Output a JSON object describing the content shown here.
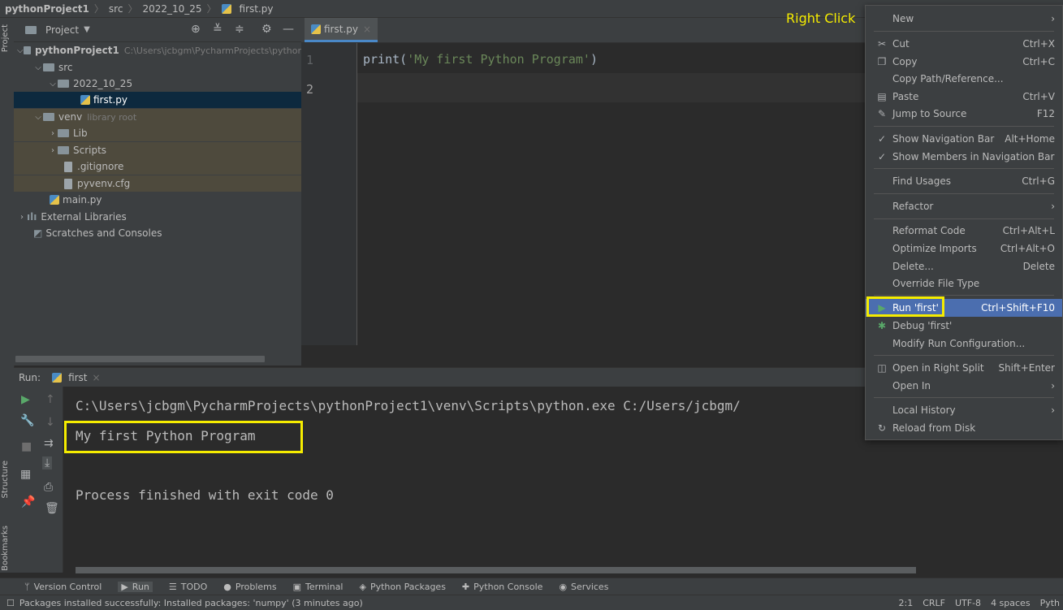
{
  "breadcrumb": {
    "project": "pythonProject1",
    "items": [
      "src",
      "2022_10_25",
      "first.py"
    ]
  },
  "side_tabs": {
    "project": "Project",
    "structure": "Structure",
    "bookmarks": "Bookmarks"
  },
  "project_panel": {
    "title": "Project",
    "tree": [
      {
        "label": "pythonProject1",
        "extra": "C:\\Users\\jcbgm\\PycharmProjects\\pythor",
        "kind": "folder",
        "expanded": true
      },
      {
        "label": "src",
        "kind": "folder",
        "expanded": true
      },
      {
        "label": "2022_10_25",
        "kind": "folder",
        "expanded": true
      },
      {
        "label": "first.py",
        "kind": "python",
        "selected": true
      },
      {
        "label": "venv",
        "extra": "library root",
        "kind": "folder",
        "expanded": true
      },
      {
        "label": "Lib",
        "kind": "folder",
        "expanded": false
      },
      {
        "label": "Scripts",
        "kind": "folder",
        "expanded": false
      },
      {
        "label": ".gitignore",
        "kind": "file"
      },
      {
        "label": "pyvenv.cfg",
        "kind": "file"
      },
      {
        "label": "main.py",
        "kind": "python"
      },
      {
        "label": "External Libraries",
        "kind": "library",
        "expanded": false
      },
      {
        "label": "Scratches and Consoles",
        "kind": "scratch"
      }
    ]
  },
  "editor": {
    "tab_label": "first.py",
    "line_numbers": [
      "1",
      "2"
    ],
    "code_prefix": "print(",
    "code_string": "'My first Python Program'",
    "code_suffix": ")"
  },
  "annotation": {
    "right_click": "Right Click"
  },
  "run_panel": {
    "label": "Run:",
    "config": "first",
    "lines": [
      "C:\\Users\\jcbgm\\PycharmProjects\\pythonProject1\\venv\\Scripts\\python.exe C:/Users/jcbgm/",
      "My first Python Program",
      "Process finished with exit code 0"
    ]
  },
  "context_menu": {
    "items": [
      {
        "label": "New",
        "shortcut": "",
        "submenu": true,
        "icon": ""
      },
      {
        "label": "Cut",
        "shortcut": "Ctrl+X",
        "icon": "scissors-icon"
      },
      {
        "label": "Copy",
        "shortcut": "Ctrl+C",
        "icon": "copy-icon"
      },
      {
        "label": "Copy Path/Reference...",
        "shortcut": "",
        "icon": ""
      },
      {
        "label": "Paste",
        "shortcut": "Ctrl+V",
        "icon": "paste-icon"
      },
      {
        "label": "Jump to Source",
        "shortcut": "F12",
        "icon": "edit-icon"
      },
      {
        "label": "Show Navigation Bar",
        "shortcut": "Alt+Home",
        "icon": "check-icon"
      },
      {
        "label": "Show Members in Navigation Bar",
        "shortcut": "",
        "icon": "check-icon"
      },
      {
        "label": "Find Usages",
        "shortcut": "Ctrl+G",
        "icon": ""
      },
      {
        "label": "Refactor",
        "shortcut": "",
        "submenu": true,
        "icon": ""
      },
      {
        "label": "Reformat Code",
        "shortcut": "Ctrl+Alt+L",
        "icon": ""
      },
      {
        "label": "Optimize Imports",
        "shortcut": "Ctrl+Alt+O",
        "icon": ""
      },
      {
        "label": "Delete...",
        "shortcut": "Delete",
        "icon": ""
      },
      {
        "label": "Override File Type",
        "shortcut": "",
        "icon": ""
      },
      {
        "label": "Run 'first'",
        "shortcut": "Ctrl+Shift+F10",
        "icon": "run-icon",
        "active": true
      },
      {
        "label": "Debug 'first'",
        "shortcut": "",
        "icon": "debug-icon"
      },
      {
        "label": "Modify Run Configuration...",
        "shortcut": "",
        "icon": ""
      },
      {
        "label": "Open in Right Split",
        "shortcut": "Shift+Enter",
        "icon": "split-icon"
      },
      {
        "label": "Open In",
        "shortcut": "",
        "submenu": true,
        "icon": ""
      },
      {
        "label": "Local History",
        "shortcut": "",
        "submenu": true,
        "icon": ""
      },
      {
        "label": "Reload from Disk",
        "shortcut": "",
        "icon": "reload-icon"
      }
    ]
  },
  "tool_windows": [
    "Version Control",
    "Run",
    "TODO",
    "Problems",
    "Terminal",
    "Python Packages",
    "Python Console",
    "Services"
  ],
  "status": {
    "message": "Packages installed successfully: Installed packages: 'numpy' (3 minutes ago)",
    "position": "2:1",
    "line_sep": "CRLF",
    "encoding": "UTF-8",
    "indent": "4 spaces",
    "interpreter": "Pyth"
  },
  "colors": {
    "highlight": "#f5ec00",
    "selection": "#4b6eaf",
    "string": "#6a8759"
  }
}
